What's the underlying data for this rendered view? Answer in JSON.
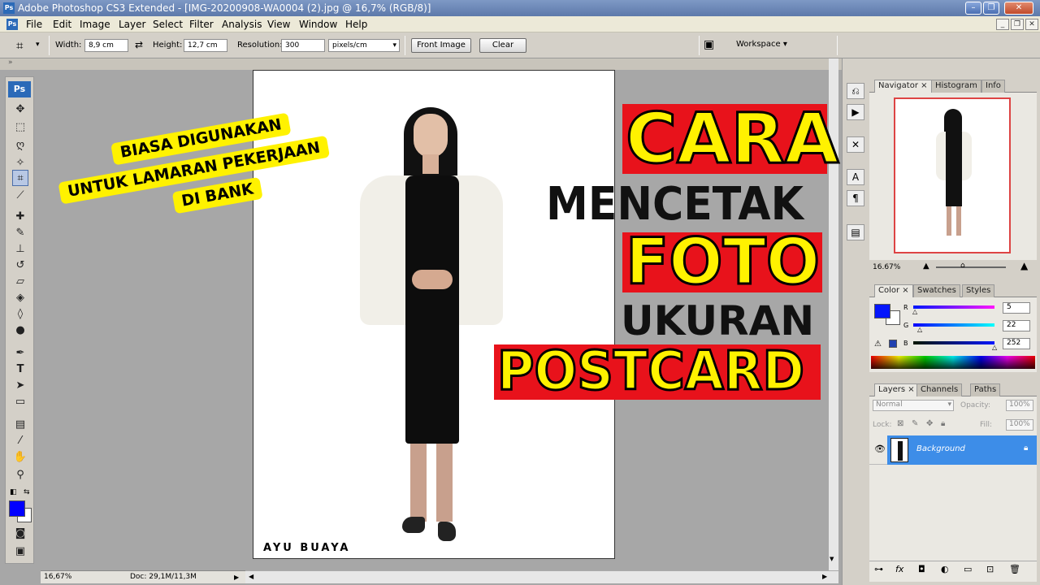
{
  "window": {
    "title": "Adobe Photoshop CS3 Extended - [IMG-20200908-WA0004 (2).jpg @ 16,7% (RGB/8)]",
    "app_icon": "Ps"
  },
  "menu": {
    "items": [
      "File",
      "Edit",
      "Image",
      "Layer",
      "Select",
      "Filter",
      "Analysis",
      "View",
      "Window",
      "Help"
    ]
  },
  "options": {
    "width_label": "Width:",
    "width_value": "8,9 cm",
    "height_label": "Height:",
    "height_value": "12,7 cm",
    "resolution_label": "Resolution:",
    "resolution_value": "300",
    "resolution_unit": "pixels/cm",
    "front_image": "Front Image",
    "clear": "Clear",
    "workspace": "Workspace"
  },
  "toolbox": {
    "logo": "Ps",
    "foreground_color": "#0000ff",
    "background_color": "#ffffff"
  },
  "document": {
    "watermark": "AYU BUAYA"
  },
  "status": {
    "zoom": "16,67%",
    "doc_size": "Doc: 29,1M/11,3M"
  },
  "navigator": {
    "tabs": [
      "Navigator",
      "Histogram",
      "Info"
    ],
    "zoom": "16.67%"
  },
  "color_panel": {
    "tabs": [
      "Color",
      "Swatches",
      "Styles"
    ],
    "channels": [
      {
        "label": "R",
        "value": "5"
      },
      {
        "label": "G",
        "value": "22"
      },
      {
        "label": "B",
        "value": "252"
      }
    ],
    "foreground": "#0516fc"
  },
  "layers_panel": {
    "tabs": [
      "Layers",
      "Channels",
      "Paths"
    ],
    "blend_mode": "Normal",
    "opacity_label": "Opacity:",
    "opacity_value": "100%",
    "lock_label": "Lock:",
    "fill_label": "Fill:",
    "fill_value": "100%",
    "layers": [
      {
        "name": "Background",
        "visible": true,
        "locked": true
      }
    ]
  },
  "overlay": {
    "yellow_note_line1": "BIASA DIGUNAKAN",
    "yellow_note_line2": "UNTUK LAMARAN PEKERJAAN",
    "yellow_note_line3": "DI BANK",
    "headline_1": "CARA",
    "headline_2": "MENCETAK",
    "headline_3": "FOTO",
    "headline_4": "UKURAN",
    "headline_5": "POSTCARD",
    "accent_yellow": "#fff200",
    "accent_red": "#e8121b"
  }
}
